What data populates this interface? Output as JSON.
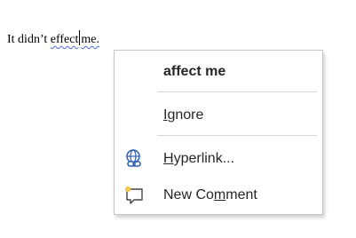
{
  "document": {
    "text_before": "It didn’t ",
    "misspelled_word": "effect",
    "text_after": "me."
  },
  "context_menu": {
    "suggestion": "affect me",
    "ignore": "Ignore",
    "hyperlink": "Hyperlink...",
    "new_comment": "New Comment"
  },
  "icons": {
    "hyperlink": "globe-chain-icon",
    "new_comment": "new-comment-icon"
  },
  "colors": {
    "spelling_underline": "#4a6cd4",
    "hyperlink_icon": "#2f5fb3",
    "comment_star": "#f2c94c"
  }
}
